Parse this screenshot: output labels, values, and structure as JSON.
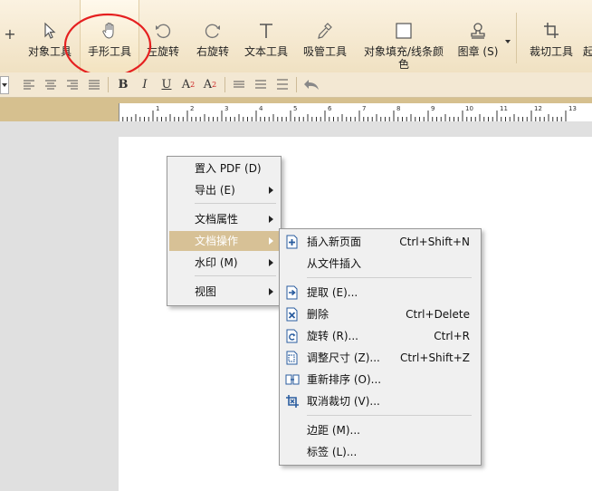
{
  "toolbar": {
    "items": [
      {
        "label": "对象工具",
        "icon": "pointer-arrow-icon"
      },
      {
        "label": "手形工具",
        "icon": "hand-icon",
        "active": true
      },
      {
        "label": "左旋转",
        "icon": "rotate-left-icon"
      },
      {
        "label": "右旋转",
        "icon": "rotate-right-icon"
      },
      {
        "label": "文本工具",
        "icon": "text-t-icon"
      },
      {
        "label": "吸管工具",
        "icon": "eyedropper-icon"
      },
      {
        "label": "对象填充/线条颜色",
        "icon": "fill-square-icon"
      },
      {
        "label": "图章 (S)",
        "icon": "stamp-icon"
      },
      {
        "label": "裁切工具",
        "icon": "crop-icon"
      }
    ]
  },
  "format_bar": {
    "bold": "B",
    "italic": "I",
    "underline": "U",
    "superscript": "A",
    "superscript_mark": "2",
    "subscript": "A",
    "subscript_mark": "2"
  },
  "ruler": {
    "labels": [
      "1",
      "2",
      "3",
      "4",
      "5",
      "6",
      "7",
      "8",
      "9",
      "10",
      "11",
      "12",
      "13"
    ]
  },
  "context_menu": {
    "items": [
      {
        "label": "置入 PDF (D)"
      },
      {
        "label": "导出 (E)",
        "submenu": true
      },
      {
        "label": "文档属性",
        "submenu": true
      },
      {
        "label": "文档操作",
        "submenu": true,
        "highlighted": true
      },
      {
        "label": "水印 (M)",
        "submenu": true
      },
      {
        "label": "视图",
        "submenu": true
      }
    ]
  },
  "submenu": {
    "items": [
      {
        "label": "插入新页面",
        "shortcut": "Ctrl+Shift+N",
        "icon": "insert-page-icon"
      },
      {
        "label": "从文件插入",
        "shortcut": ""
      },
      {
        "label": "提取 (E)...",
        "shortcut": "",
        "icon": "extract-page-icon"
      },
      {
        "label": "删除",
        "shortcut": "Ctrl+Delete",
        "icon": "delete-page-icon"
      },
      {
        "label": "旋转 (R)...",
        "shortcut": "Ctrl+R",
        "icon": "rotate-page-icon"
      },
      {
        "label": "调整尺寸 (Z)...",
        "shortcut": "Ctrl+Shift+Z",
        "icon": "resize-page-icon"
      },
      {
        "label": "重新排序 (O)...",
        "shortcut": "",
        "icon": "reorder-pages-icon"
      },
      {
        "label": "取消裁切 (V)...",
        "shortcut": "",
        "icon": "uncrop-icon"
      },
      {
        "label": "边距 (M)...",
        "shortcut": ""
      },
      {
        "label": "标签 (L)...",
        "shortcut": ""
      }
    ]
  },
  "colors": {
    "annotation": "#e52020",
    "menu_highlight": "#d7c196",
    "toolbar_bg": "#f3e6cb"
  }
}
